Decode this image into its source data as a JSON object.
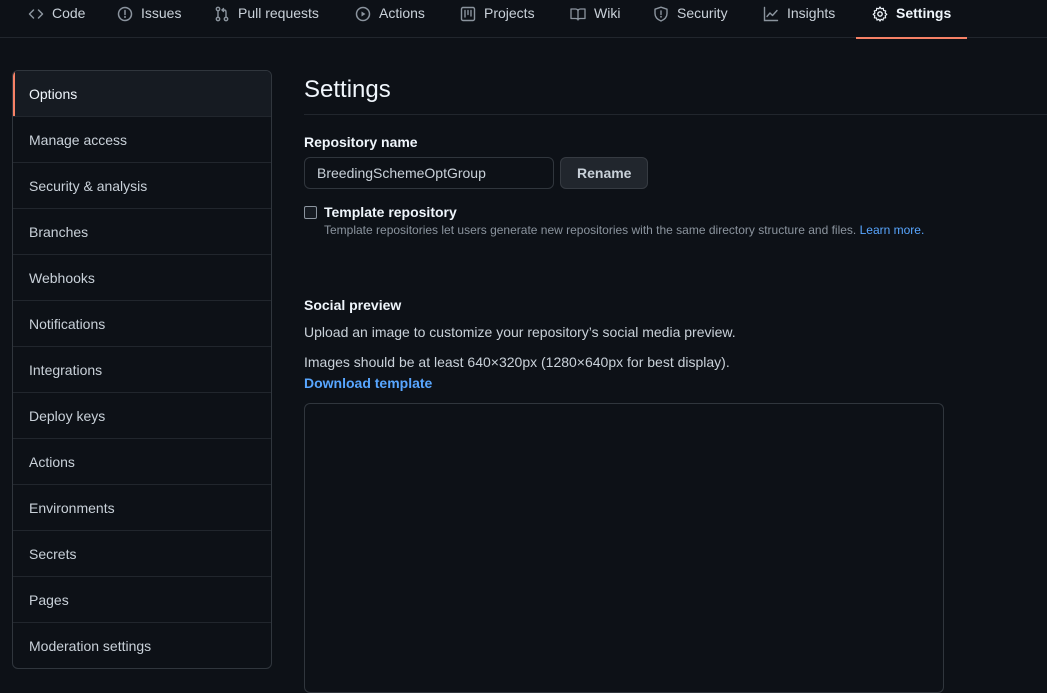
{
  "nav": {
    "tabs": [
      {
        "label": "Code",
        "icon": "code-icon"
      },
      {
        "label": "Issues",
        "icon": "issue-opened-icon"
      },
      {
        "label": "Pull requests",
        "icon": "git-pull-request-icon"
      },
      {
        "label": "Actions",
        "icon": "play-icon"
      },
      {
        "label": "Projects",
        "icon": "project-icon"
      },
      {
        "label": "Wiki",
        "icon": "book-icon"
      },
      {
        "label": "Security",
        "icon": "shield-icon"
      },
      {
        "label": "Insights",
        "icon": "graph-icon"
      },
      {
        "label": "Settings",
        "icon": "gear-icon",
        "selected": true
      }
    ]
  },
  "sidebar": {
    "items": [
      {
        "label": "Options",
        "selected": true
      },
      {
        "label": "Manage access"
      },
      {
        "label": "Security & analysis"
      },
      {
        "label": "Branches"
      },
      {
        "label": "Webhooks"
      },
      {
        "label": "Notifications"
      },
      {
        "label": "Integrations"
      },
      {
        "label": "Deploy keys"
      },
      {
        "label": "Actions"
      },
      {
        "label": "Environments"
      },
      {
        "label": "Secrets"
      },
      {
        "label": "Pages"
      },
      {
        "label": "Moderation settings"
      }
    ]
  },
  "main": {
    "title": "Settings",
    "repo_name_label": "Repository name",
    "repo_name_value": "BreedingSchemeOptGroup",
    "rename_button": "Rename",
    "template_label": "Template repository",
    "template_note": "Template repositories let users generate new repositories with the same directory structure and files.",
    "template_link": "Learn more.",
    "social_label": "Social preview",
    "social_para1": "Upload an image to customize your repository’s social media preview.",
    "social_para2": "Images should be at least 640×320px (1280×640px for best display).",
    "download_link": "Download template"
  },
  "colors": {
    "background": "#0d1117",
    "accent": "#f78166",
    "link": "#58a6ff",
    "border": "#30363d"
  }
}
